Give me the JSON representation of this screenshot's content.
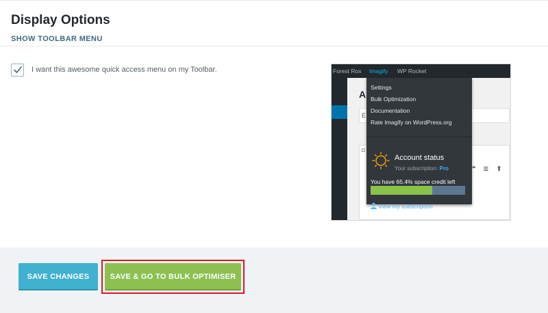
{
  "section": {
    "title": "Display Options",
    "subtitle": "SHOW TOOLBAR MENU"
  },
  "toolbar_option": {
    "checked": true,
    "label": "I want this awesome quick access menu on my Toolbar."
  },
  "preview": {
    "admin_bar": [
      "Forest Rox",
      "Imagify",
      "WP Rocket"
    ],
    "active_item": "Imagify",
    "content_letter": "A",
    "input_letter": "E",
    "menu_items": [
      "Settings",
      "Bulk Optimization",
      "Documentation",
      "Rate Imagify on WordPress.org"
    ],
    "account_title": "Account status",
    "subscription_label": "Your subscription:",
    "subscription_plan": "Pro",
    "credit_text": "You have 65.4% space credit left",
    "credit_percent": 65.4,
    "view_link": "View my subscription",
    "colors": {
      "fill": "#8bc34a",
      "track": "#5e7791",
      "accent": "#3db0f7"
    }
  },
  "buttons": {
    "save_label": "SAVE CHANGES",
    "bulk_label": "SAVE & GO TO BULK OPTIMISER"
  },
  "colors": {
    "save_button": "#40b1d0",
    "bulk_button": "#8cc152",
    "highlight_border": "#e2141f"
  }
}
